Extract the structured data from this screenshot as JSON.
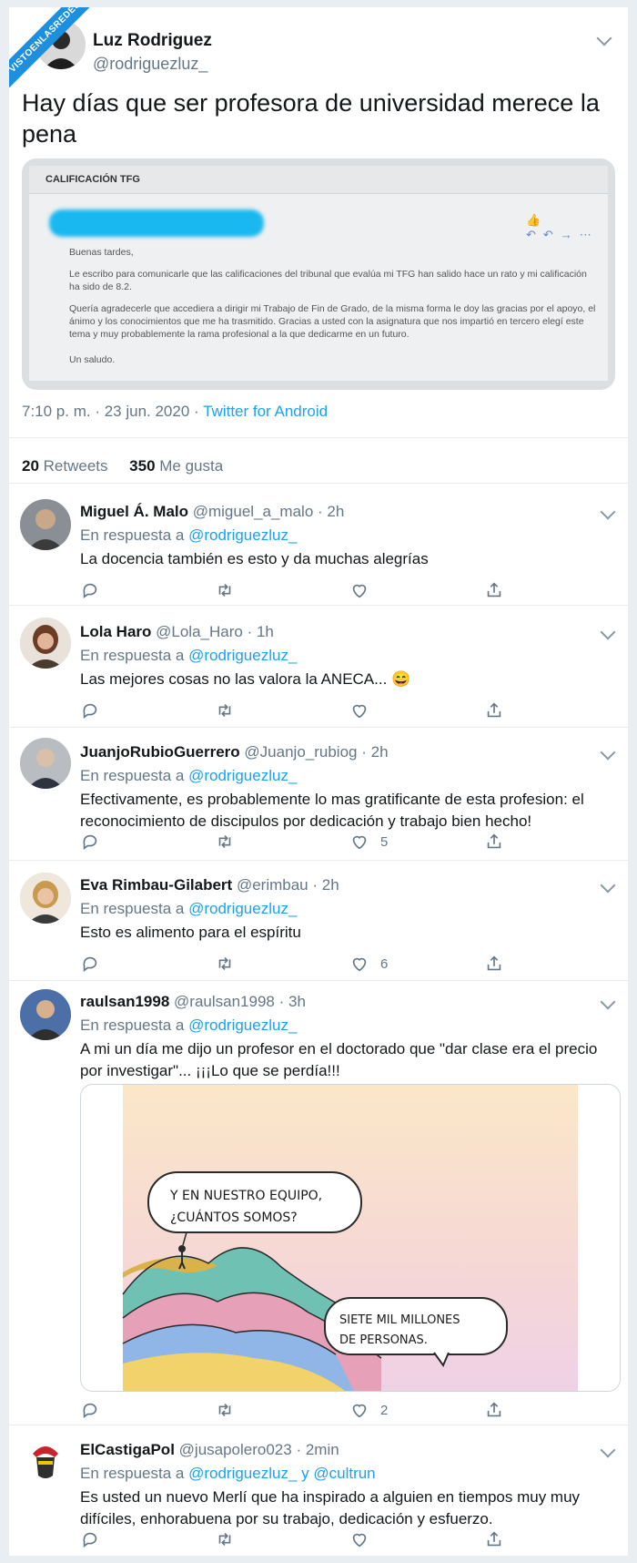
{
  "watermark": "VISTOENLASREDES",
  "main": {
    "name": "Luz Rodriguez",
    "handle": "@rodriguezluz_",
    "text": "Hay días que ser profesora de universidad merece la pena",
    "card": {
      "header": "CALIFICACIÓN TFG",
      "greeting": "Buenas tardes,",
      "p1": "Le escribo para comunicarle que las calificaciones del tribunal que evalúa mi TFG han salido hace un rato y mi calificación ha sido de 8.2.",
      "p2": "Quería agradecerle que accediera a dirigir mi Trabajo de Fin de Grado, de la misma forma le doy las gracias por el apoyo, el ánimo y los conocimientos que me ha trasmitido. Gracias a usted con la asignatura que nos impartió en tercero elegí este tema y muy probablemente la rama profesional a la que dedicarme en un futuro.",
      "closing": "Un saludo."
    },
    "time": "7:10 p. m. · 23 jun. 2020 · ",
    "app": "Twitter for Android",
    "retweets_count": "20",
    "retweets_label": "Retweets",
    "likes_count": "350",
    "likes_label": "Me gusta"
  },
  "reply_prefix": "En respuesta a ",
  "replies": [
    {
      "name": "Miguel Á. Malo",
      "handle": "@miguel_a_malo",
      "time": "2h",
      "to": "@rodriguezluz_",
      "text": "La docencia también es esto y da muchas alegrías",
      "likes": ""
    },
    {
      "name": "Lola Haro",
      "handle": "@Lola_Haro",
      "time": "1h",
      "to": "@rodriguezluz_",
      "text": "Las mejores cosas no las valora la ANECA... 😄",
      "likes": ""
    },
    {
      "name": "JuanjoRubioGuerrero",
      "handle": "@Juanjo_rubiog",
      "time": "2h",
      "to": "@rodriguezluz_",
      "text": "Efectivamente, es probablemente lo mas gratificante de esta profesion: el reconocimiento de discipulos por dedicación y trabajo bien hecho!",
      "likes": "5"
    },
    {
      "name": "Eva Rimbau-Gilabert",
      "handle": "@erimbau",
      "time": "2h",
      "to": "@rodriguezluz_",
      "text": "Esto es alimento para el espíritu",
      "likes": "6"
    },
    {
      "name": "raulsan1998",
      "handle": "@raulsan1998",
      "time": "3h",
      "to": "@rodriguezluz_",
      "text": "A mi un día me dijo un profesor en el doctorado que \"dar clase era el precio por investigar\"... ¡¡¡Lo que se perdía!!!",
      "likes": "2",
      "bubble1_l1": "Y EN NUESTRO EQUIPO,",
      "bubble1_l2": "¿CUÁNTOS SOMOS?",
      "bubble2_l1": "SIETE MIL MILLONES",
      "bubble2_l2": "DE PERSONAS."
    },
    {
      "name": "ElCastigaPol",
      "handle": "@jusapolero023",
      "time": "2min",
      "to": "@rodriguezluz_",
      "to_join": " y ",
      "to2": "@cultrun",
      "text": "Es usted un nuevo Merlí que ha inspirado a alguien en tiempos muy muy difíciles, enhorabuena por su trabajo, dedicación y esfuerzo.",
      "likes": ""
    }
  ]
}
